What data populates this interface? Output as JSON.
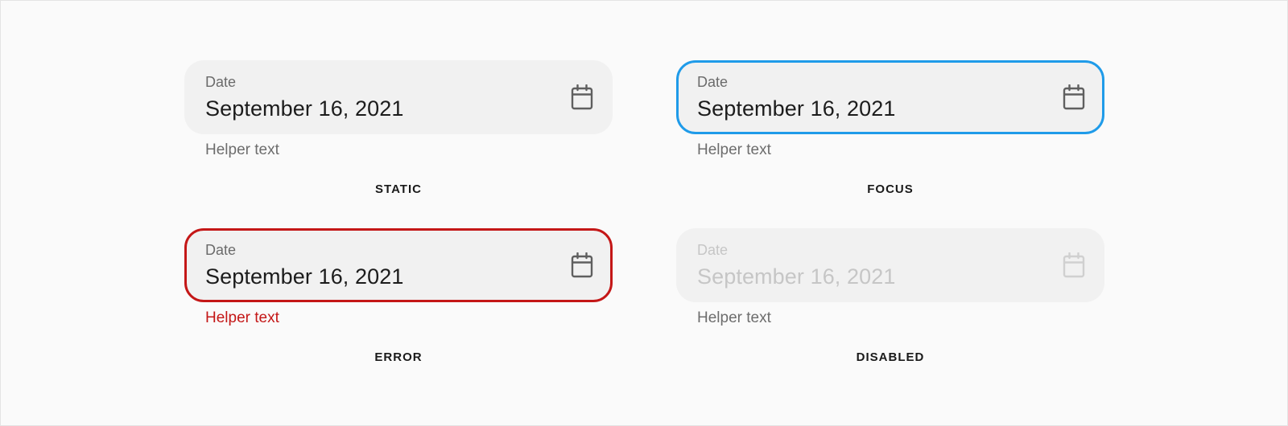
{
  "variants": [
    {
      "state": "STATIC",
      "field_label": "Date",
      "field_value": "September 16, 2021",
      "helper": "Helper text",
      "icon": "calendar-icon"
    },
    {
      "state": "FOCUS",
      "field_label": "Date",
      "field_value": "September 16, 2021",
      "helper": "Helper text",
      "icon": "calendar-icon"
    },
    {
      "state": "ERROR",
      "field_label": "Date",
      "field_value": "September 16, 2021",
      "helper": "Helper text",
      "icon": "calendar-icon"
    },
    {
      "state": "DISABLED",
      "field_label": "Date",
      "field_value": "September 16, 2021",
      "helper": "Helper text",
      "icon": "calendar-icon"
    }
  ],
  "colors": {
    "background": "#fafafa",
    "field_fill": "#f1f1f1",
    "focus_border": "#1f9be9",
    "error_border": "#c41717",
    "disabled_text": "#c6c6c6",
    "icon": "#5f5f5f",
    "icon_disabled": "#d0d0d0"
  }
}
